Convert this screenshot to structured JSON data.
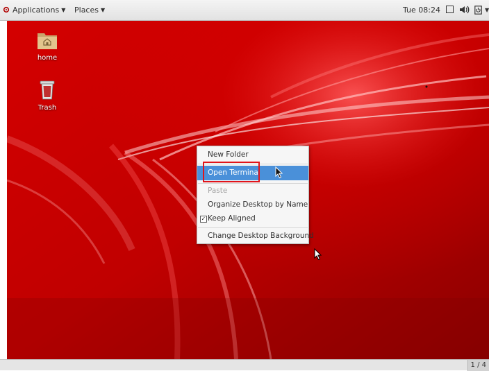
{
  "top_panel": {
    "applications": "Applications",
    "places": "Places",
    "clock": "Tue 08:24"
  },
  "desktop_icons": [
    {
      "label": "home",
      "icon": "home-folder-icon"
    },
    {
      "label": "Trash",
      "icon": "trash-icon"
    }
  ],
  "context_menu": {
    "items": [
      {
        "label": "New Folder",
        "state": "normal"
      },
      {
        "label": "Open Terminal",
        "state": "highlighted"
      },
      {
        "label": "Paste",
        "state": "disabled"
      },
      {
        "label": "Organize Desktop by Name",
        "state": "normal"
      },
      {
        "label": "Keep Aligned",
        "state": "checked"
      },
      {
        "label": "Change Desktop Background",
        "state": "normal"
      }
    ],
    "check_mark": "✓"
  },
  "bottom_panel": {
    "workspace": "1 / 4"
  },
  "colors": {
    "wallpaper": "#c80000",
    "highlight": "#4a90d9",
    "annotation": "#e1141a"
  }
}
